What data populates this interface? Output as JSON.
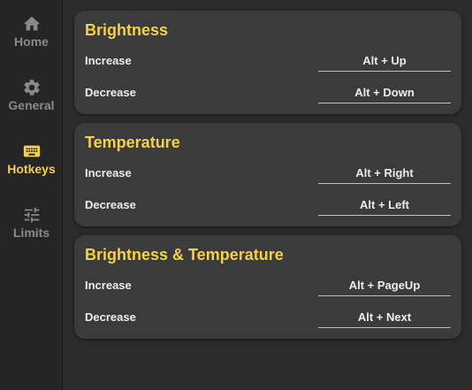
{
  "sidebar": {
    "items": [
      {
        "label": "Home",
        "icon": "home-icon",
        "active": false
      },
      {
        "label": "General",
        "icon": "gear-icon",
        "active": false
      },
      {
        "label": "Hotkeys",
        "icon": "keyboard-icon",
        "active": true
      },
      {
        "label": "Limits",
        "icon": "sliders-icon",
        "active": false
      }
    ]
  },
  "sections": [
    {
      "title": "Brightness",
      "rows": [
        {
          "label": "Increase",
          "hotkey": "Alt + Up"
        },
        {
          "label": "Decrease",
          "hotkey": "Alt + Down"
        }
      ]
    },
    {
      "title": "Temperature",
      "rows": [
        {
          "label": "Increase",
          "hotkey": "Alt + Right"
        },
        {
          "label": "Decrease",
          "hotkey": "Alt + Left"
        }
      ]
    },
    {
      "title": "Brightness & Temperature",
      "rows": [
        {
          "label": "Increase",
          "hotkey": "Alt + PageUp"
        },
        {
          "label": "Decrease",
          "hotkey": "Alt + Next"
        }
      ]
    }
  ],
  "colors": {
    "accent": "#f5d04b",
    "inactive_nav": "#8a8a8a",
    "card_bg": "#3b3b3b",
    "window_bg": "#2b2b2b",
    "sidebar_bg": "#252525"
  }
}
